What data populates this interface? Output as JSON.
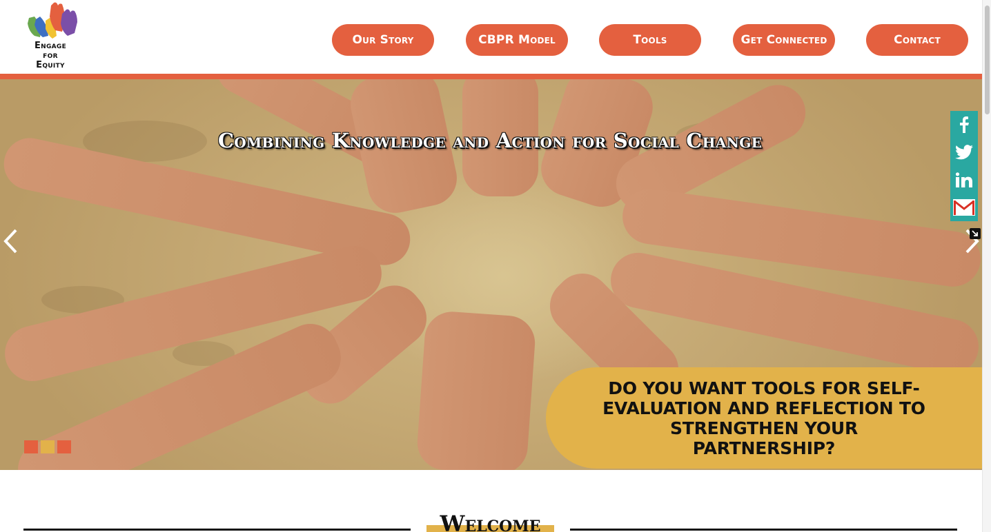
{
  "brand": {
    "logo_lines": [
      "Engage",
      "for",
      "Equity"
    ],
    "colors": {
      "accent": "#e4603f",
      "gold": "#e2b24a",
      "teal": "#2aa8a1"
    }
  },
  "nav": {
    "items": [
      {
        "label": "Our Story"
      },
      {
        "label": "CBPR Model"
      },
      {
        "label": "Tools"
      },
      {
        "label": "Get Connected"
      },
      {
        "label": "Contact"
      }
    ]
  },
  "hero": {
    "title": "Combining Knowledge and Action for Social Change",
    "cta": "Do you want tools for self-evaluation and reflection to strengthen your partnership?",
    "prev_icon": "chevron-left-icon",
    "next_icon": "chevron-right-icon",
    "slide_dots": [
      {
        "color": "#e4603f"
      },
      {
        "color": "#e2b24a"
      },
      {
        "color": "#e4603f"
      }
    ]
  },
  "social": {
    "items": [
      {
        "icon": "facebook-icon"
      },
      {
        "icon": "twitter-icon"
      },
      {
        "icon": "linkedin-icon"
      },
      {
        "icon": "gmail-icon"
      }
    ]
  },
  "welcome": {
    "title": "Welcome"
  }
}
